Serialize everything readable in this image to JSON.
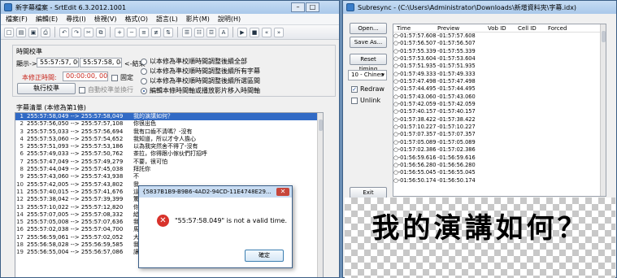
{
  "srtedit": {
    "title": "新字幕檔案 - SrtEdit 6.3.2012.1001",
    "menu": [
      "檔案(F)",
      "編輯(E)",
      "尋找(I)",
      "檢視(V)",
      "格式(O)",
      "語言(L)",
      "影片(M)",
      "說明(H)"
    ],
    "timing_group": "時間校準",
    "display_label": "顯示->",
    "start_time": "55:57:57, 060",
    "end_time": "55:57:58, 049",
    "end_arrow": "<-結束",
    "deviation_label": "本修正時間:",
    "deviation_value": "00:00:00, 000",
    "fixed_label": "固定",
    "execute_button": "執行校準",
    "auto_label": "自動校準並換行",
    "options": [
      "以本修為準校順時間調整後續全部",
      "以本修為準校順時間調整後續所有字幕",
      "以本修為準校順時間調整後續所選區間",
      "編輯本條時間軸或播放影片移入時間軸"
    ],
    "list_title": "字幕清單 (本修為第1條)",
    "rows": [
      {
        "n": "1",
        "t": "255:57:58,049 --> 255:57:58,049",
        "x": "我的演講如何？"
      },
      {
        "n": "2",
        "t": "255:57:56,050 --> 255:57:57,108",
        "x": "你很出色"
      },
      {
        "n": "3",
        "t": "255:57:55,033 --> 255:57:56,694",
        "x": "我有口齒不清嗎？-沒有"
      },
      {
        "n": "4",
        "t": "255:57:53,060 --> 255:57:54,652",
        "x": "我知道，所以才令人擔心"
      },
      {
        "n": "5",
        "t": "255:57:51,093 --> 255:57:53,186",
        "x": "以為我突然舍不得了-沒有"
      },
      {
        "n": "6",
        "t": "255:57:49,033 --> 255:57:50,762",
        "x": "茶拉，你得跟小傢伙們打招呼"
      },
      {
        "n": "7",
        "t": "255:57:47,049 --> 255:57:49,279",
        "x": "不要，很可怕"
      },
      {
        "n": "8",
        "t": "255:57:44,049 --> 255:57:45,038",
        "x": "拜託你"
      },
      {
        "n": "9",
        "t": "255:57:43,060 --> 255:57:43,938",
        "x": "不"
      },
      {
        "n": "10",
        "t": "255:57:42,005 --> 255:57:43,802",
        "x": "我"
      },
      {
        "n": "11",
        "t": "255:57:40,015 --> 255:57:41,676",
        "x": "這"
      },
      {
        "n": "12",
        "t": "255:57:38,042 --> 255:57:39,399",
        "x": "驚"
      },
      {
        "n": "13",
        "t": "255:57:10,022 --> 255:57:12,820",
        "x": "你"
      },
      {
        "n": "14",
        "t": "255:57:07,005 --> 255:57:08,332",
        "x": "給"
      },
      {
        "n": "15",
        "t": "255:57:05,008 --> 255:57:07,636",
        "x": "我"
      },
      {
        "n": "16",
        "t": "255:57:02,038 --> 255:57:04,700",
        "x": "馬"
      },
      {
        "n": "17",
        "t": "255:56:59,061 --> 255:57:02,052",
        "x": "大"
      },
      {
        "n": "18",
        "t": "255:56:58,028 --> 255:56:59,585",
        "x": "我"
      },
      {
        "n": "19",
        "t": "255:56:55,004 --> 255:56:57,086",
        "x": "讓我過去，一定要拯救她"
      }
    ]
  },
  "dialog": {
    "title": "{5837B1B9-B9B6-4AD2-94CD-11E4748E29...",
    "close": "✕",
    "message": "\"55:57:58.049\" is not a valid time.",
    "ok": "確定",
    "icon": "error-icon"
  },
  "subresync": {
    "title": "Subresync - (C:\\Users\\Administrator\\Downloads\\新增資料夾\\字幕.idx)",
    "buttons": {
      "open": "Open...",
      "save": "Save As...",
      "reset": "Reset timing",
      "exit": "Exit"
    },
    "language": "10 - Chines",
    "redraw_label": "Redraw",
    "unlink_label": "Unlink",
    "columns": [
      "Time",
      "Preview",
      "Vob ID",
      "Cell ID",
      "Forced"
    ],
    "rows": [
      {
        "time": "-01:57:57.608",
        "prev": "-01:57:57.608"
      },
      {
        "time": "-01:57:56.507",
        "prev": "-01:57:56.507"
      },
      {
        "time": "-01:57:55.339",
        "prev": "-01:57:55.339"
      },
      {
        "time": "-01:57:53.604",
        "prev": "-01:57:53.604"
      },
      {
        "time": "-01:57:51.935",
        "prev": "-01:57:51.935"
      },
      {
        "time": "-01:57:49.333",
        "prev": "-01:57:49.333"
      },
      {
        "time": "-01:57:47.498",
        "prev": "-01:57:47.498"
      },
      {
        "time": "-01:57:44.495",
        "prev": "-01:57:44.495"
      },
      {
        "time": "-01:57:43.060",
        "prev": "-01:57:43.060"
      },
      {
        "time": "-01:57:42.059",
        "prev": "-01:57:42.059"
      },
      {
        "time": "-01:57:40.157",
        "prev": "-01:57:40.157"
      },
      {
        "time": "-01:57:38.422",
        "prev": "-01:57:38.422"
      },
      {
        "time": "-01:57:10.227",
        "prev": "-01:57:10.227"
      },
      {
        "time": "-01:57:07.357",
        "prev": "-01:57:07.357"
      },
      {
        "time": "-01:57:05.089",
        "prev": "-01:57:05.089"
      },
      {
        "time": "-01:57:02.386",
        "prev": "-01:57:02.386"
      },
      {
        "time": "-01:56:59.616",
        "prev": "-01:56:59.616"
      },
      {
        "time": "-01:56:56.280",
        "prev": "-01:56:56.280"
      },
      {
        "time": "-01:56:55.045",
        "prev": "-01:56:55.045"
      },
      {
        "time": "-01:56:50.174",
        "prev": "-01:56:50.174"
      }
    ],
    "preview_text": "我的演講如何？"
  }
}
